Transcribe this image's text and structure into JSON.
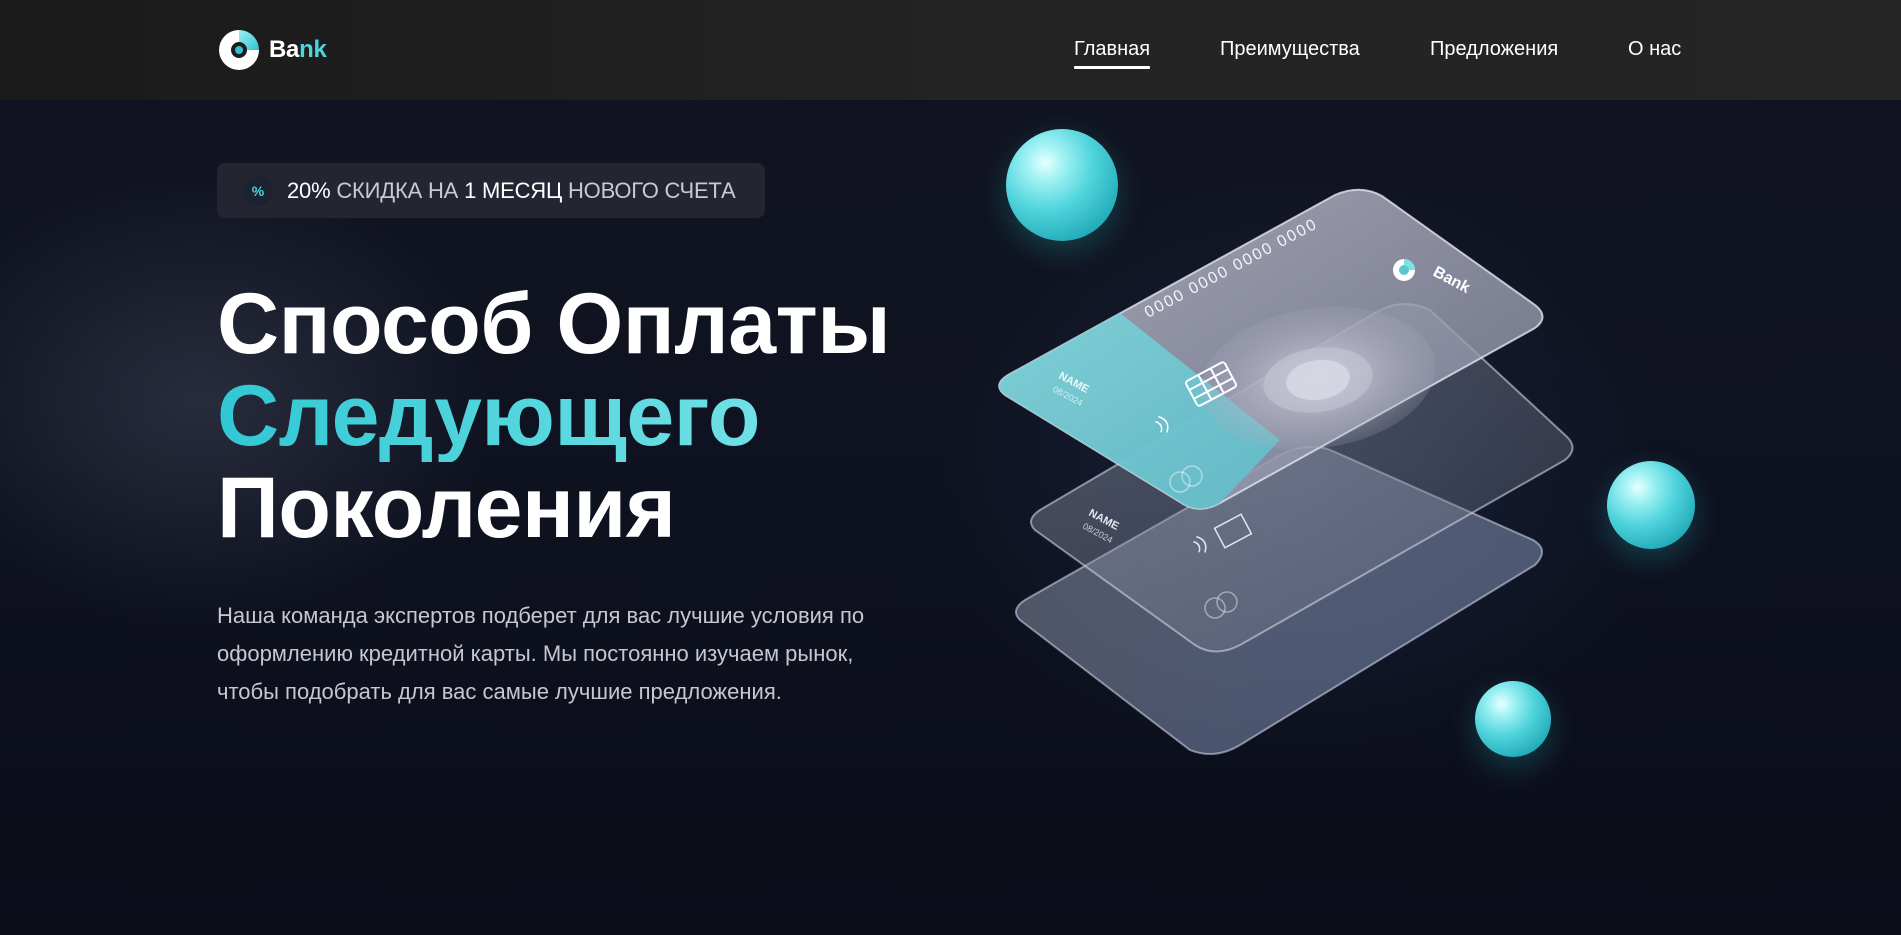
{
  "header": {
    "logo": {
      "part1": "Ba",
      "part2": "nk"
    },
    "nav": [
      {
        "label": "Главная",
        "active": true
      },
      {
        "label": "Преимущества",
        "active": false
      },
      {
        "label": "Предложения",
        "active": false
      },
      {
        "label": "О нас",
        "active": false
      }
    ]
  },
  "promo": {
    "icon": "percent-icon",
    "parts": [
      "20%",
      "СКИДКА НА",
      "1 МЕСЯЦ",
      "НОВОГО СЧЕТА"
    ]
  },
  "hero": {
    "line1": "Способ Оплаты",
    "line2": "Следующего",
    "line3": "Поколения",
    "description": [
      "Наша команда экспертов подберет для вас лучшие условия по",
      "оформлению кредитной карты. Мы постоянно изучаем рынок,",
      "чтобы подобрать для вас самые лучшие предложения."
    ]
  },
  "cards": {
    "number": "0000 0000 0000 0000",
    "name": "NAME",
    "date": "08/2024",
    "brand": "Bank"
  },
  "colors": {
    "accent": "#4ad6dd",
    "background": "#0e111b",
    "header": "#222222"
  }
}
